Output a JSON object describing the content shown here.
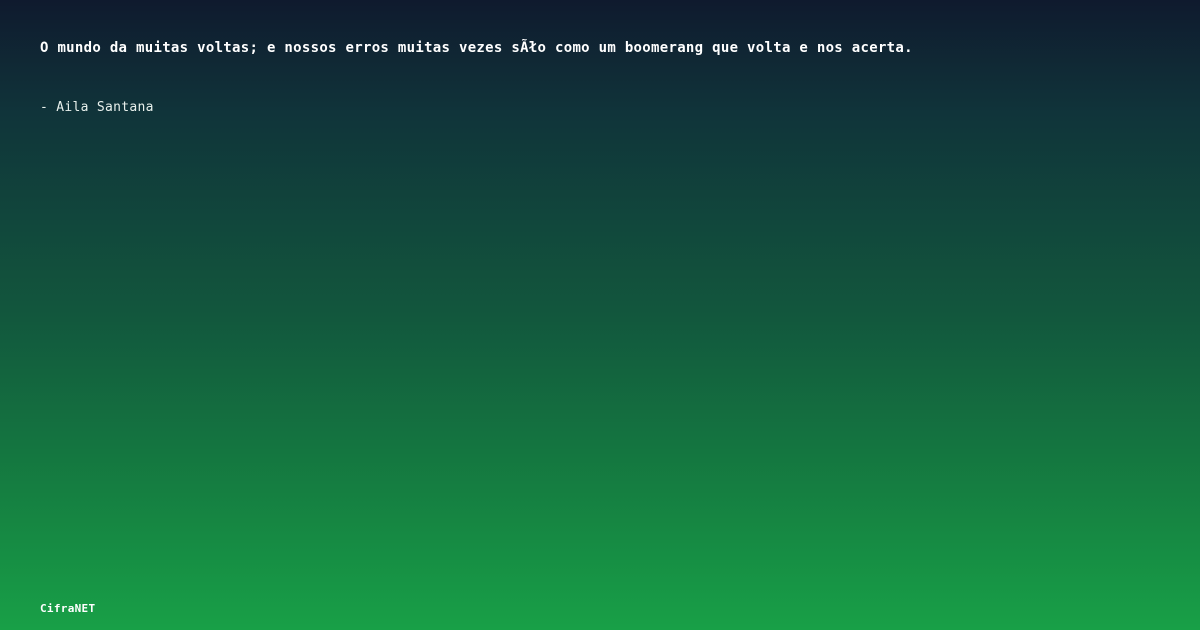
{
  "quote": {
    "text": "O mundo da muitas voltas; e nossos erros muitas vezes sÃło como um boomerang que volta e nos acerta.",
    "author": "- Aila Santana"
  },
  "brand": {
    "name": "CifraNET"
  }
}
